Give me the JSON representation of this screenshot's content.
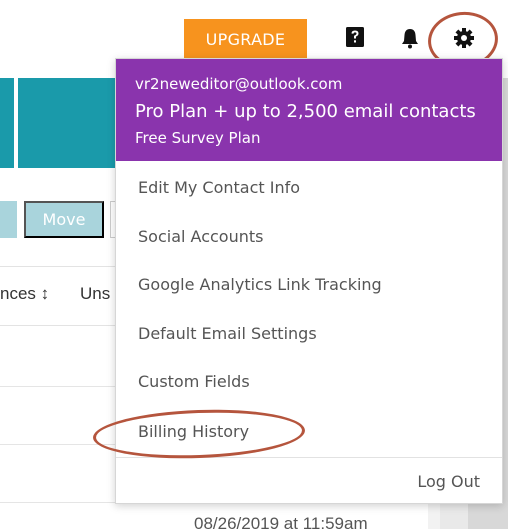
{
  "topbar": {
    "upgrade_label": "UPGRADE",
    "icons": [
      "help-icon",
      "bell-icon",
      "gear-icon"
    ]
  },
  "toolbar": {
    "move_label": "Move"
  },
  "table": {
    "headers": [
      "nces",
      "Uns"
    ],
    "date_cell": "08/26/2019 at 11:59am"
  },
  "menu": {
    "email": "vr2neweditor@outlook.com",
    "plan": "Pro Plan + up to 2,500 email contacts",
    "survey_plan": "Free Survey Plan",
    "items": [
      "Edit My Contact Info",
      "Social Accounts",
      "Google Analytics Link Tracking",
      "Default Email Settings",
      "Custom Fields",
      "Billing History"
    ],
    "logout": "Log Out"
  },
  "colors": {
    "upgrade": "#f7931e",
    "menu_header": "#8a34ad",
    "teal": "#1a9aaa",
    "annotation": "#b5553d"
  }
}
